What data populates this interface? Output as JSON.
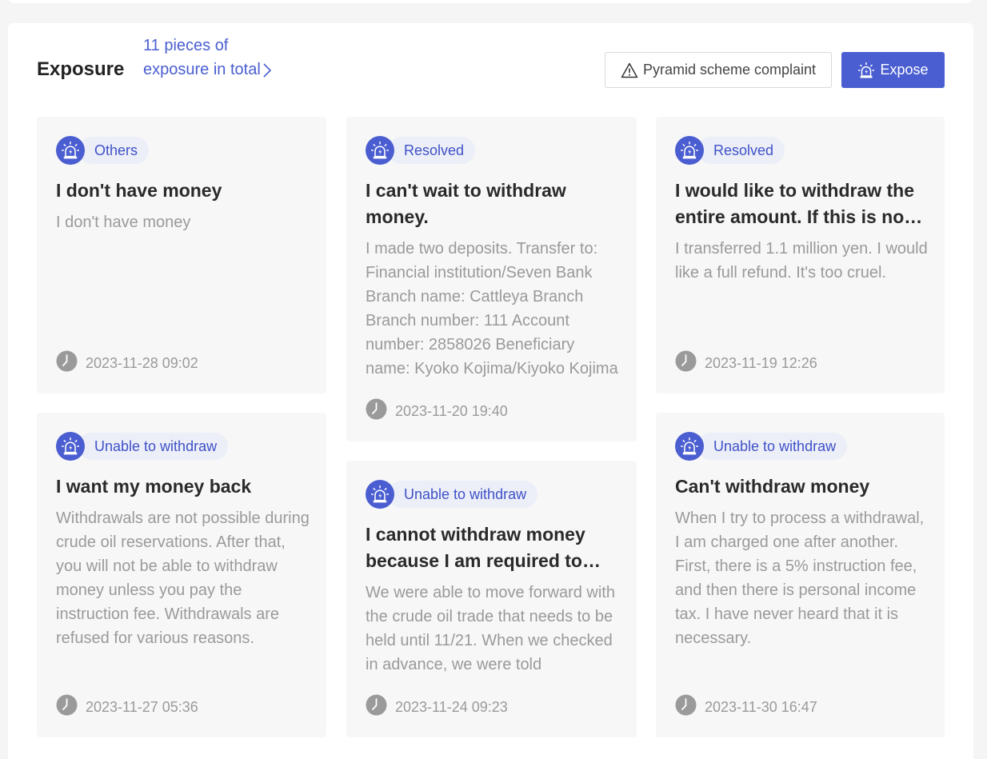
{
  "header": {
    "title": "Exposure",
    "total_link": "11 pieces of exposure in total",
    "complaint_button": "Pyramid scheme complaint",
    "expose_button": "Expose"
  },
  "colors": {
    "accent": "#4a5ed1",
    "badge_bg": "#eceef8",
    "card_bg": "#f7f7f7",
    "muted_text": "#9a9a9a"
  },
  "icons": {
    "badge": "siren-alert-icon",
    "complaint": "warning-triangle-icon",
    "time": "clock-icon",
    "more": "chevron-right-icon"
  },
  "cards": [
    {
      "category": "Others",
      "title": "I don't have money",
      "description": "I don't have money",
      "time": "2023-11-28 09:02"
    },
    {
      "category": "Resolved",
      "title": "I can't wait to withdraw money.",
      "description": "I made two deposits. Transfer to: Financial institution/Seven Bank Branch name: Cattleya Branch Branch number: 111 Account number: 2858026 Beneficiary name: Kyoko Kojima/Kiyoko Kojima",
      "time": "2023-11-20 19:40"
    },
    {
      "category": "Resolved",
      "title": "I would like to withdraw the entire amount. If this is not possible",
      "description": "I transferred 1.1 million yen. I would like a full refund. It's too cruel.",
      "time": "2023-11-19 12:26"
    },
    {
      "category": "Unable to withdraw",
      "title": "I want my money back",
      "description": "Withdrawals are not possible during crude oil reservations. After that, you will not be able to withdraw money unless you pay the instruction fee. Withdrawals are refused for various reasons.",
      "time": "2023-11-27 05:36"
    },
    {
      "category": "Unable to withdraw",
      "title": "I cannot withdraw money because I am required to pay",
      "description": "We were able to move forward with the crude oil trade that needs to be held until 11/21. When we checked in advance, we were told",
      "time": "2023-11-24 09:23"
    },
    {
      "category": "Unable to withdraw",
      "title": "Can't withdraw money",
      "description": "When I try to process a withdrawal, I am charged one after another. First, there is a 5% instruction fee, and then there is personal income tax. I have never heard that it is necessary.",
      "time": "2023-11-30 16:47"
    }
  ]
}
